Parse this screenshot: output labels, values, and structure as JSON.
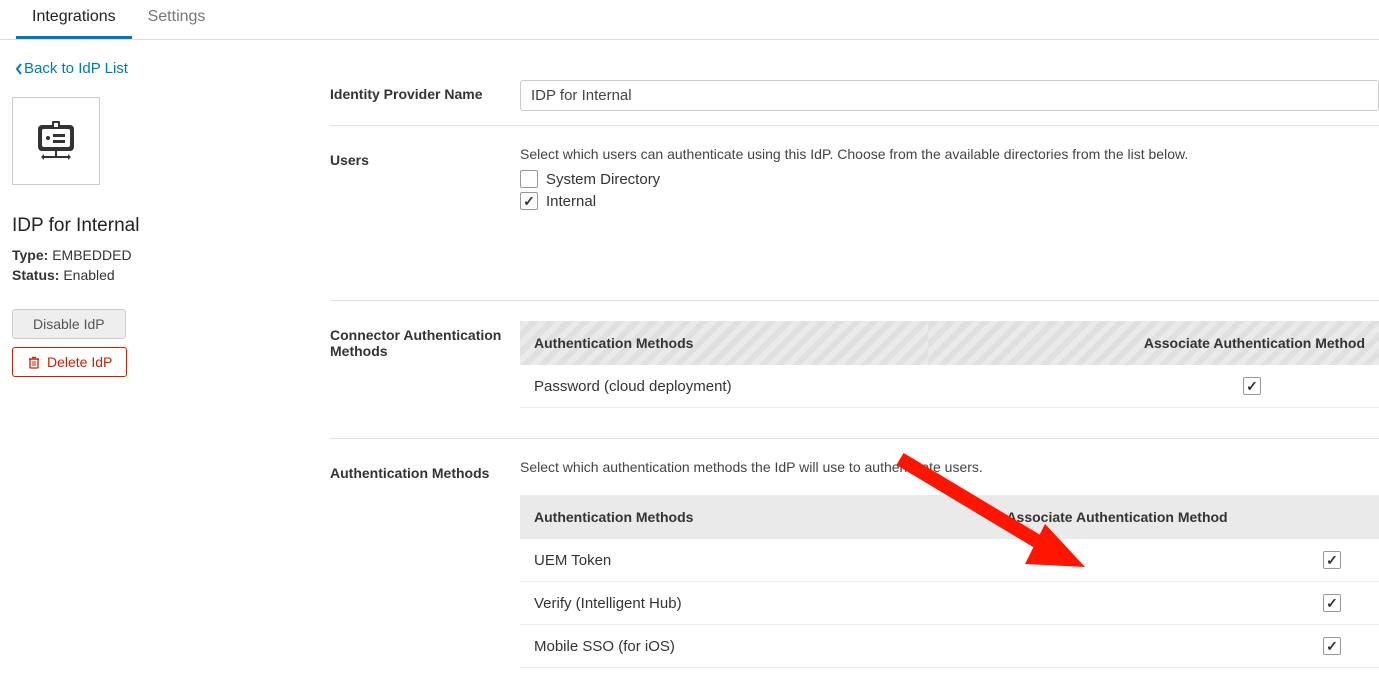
{
  "tabs": {
    "integrations": "Integrations",
    "settings": "Settings"
  },
  "back_link": "Back to IdP List",
  "sidebar": {
    "title": "IDP for Internal",
    "type_label": "Type:",
    "type_value": "EMBEDDED",
    "status_label": "Status:",
    "status_value": "Enabled",
    "disable_btn": "Disable IdP",
    "delete_btn": "Delete IdP"
  },
  "form": {
    "name_label": "Identity Provider Name",
    "name_value": "IDP for Internal",
    "users_label": "Users",
    "users_help": "Select which users can authenticate using this IdP. Choose from the available directories from the list below.",
    "users_options": [
      {
        "label": "System Directory",
        "checked": false
      },
      {
        "label": "Internal",
        "checked": true
      }
    ],
    "connector_label": "Connector Authentication Methods",
    "auth_methods_label": "Authentication Methods",
    "auth_help": "Select which authentication methods the IdP will use to authenticate users.",
    "table_headers": {
      "methods": "Authentication Methods",
      "associate": "Associate Authentication Method"
    },
    "connector_rows": [
      {
        "name": "Password (cloud deployment)",
        "checked": true
      }
    ],
    "auth_rows": [
      {
        "name": "UEM Token",
        "checked": true
      },
      {
        "name": "Verify (Intelligent Hub)",
        "checked": true
      },
      {
        "name": "Mobile SSO (for iOS)",
        "checked": true
      }
    ]
  }
}
